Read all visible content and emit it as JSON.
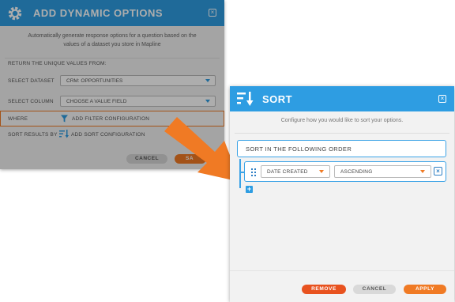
{
  "back_dialog": {
    "title": "ADD DYNAMIC OPTIONS",
    "close_icon": "close-icon",
    "description": "Automatically generate response options for a question based on the values of a dataset you store in Mapline",
    "return_label": "RETURN THE UNIQUE VALUES FROM:",
    "dataset_label": "SELECT DATASET",
    "dataset_value": "CRM: OPPORTUNITIES",
    "column_label": "SELECT COLUMN",
    "column_value": "CHOOSE A VALUE FIELD",
    "where_label": "WHERE",
    "filter_link": "ADD FILTER CONFIGURATION",
    "sort_label": "SORT RESULTS BY",
    "sort_link": "ADD SORT CONFIGURATION",
    "cancel_label": "CANCEL",
    "save_label": "SA"
  },
  "sort_dialog": {
    "title": "SORT",
    "description": "Configure how you would like to sort your options.",
    "order_label": "SORT IN THE FOLLOWING ORDER",
    "rows": [
      {
        "field": "DATE CREATED",
        "direction": "ASCENDING"
      }
    ],
    "remove_label": "REMOVE",
    "cancel_label": "CANCEL",
    "apply_label": "APPLY"
  },
  "colors": {
    "accent_blue": "#2e9de2",
    "accent_orange": "#f07a24"
  }
}
